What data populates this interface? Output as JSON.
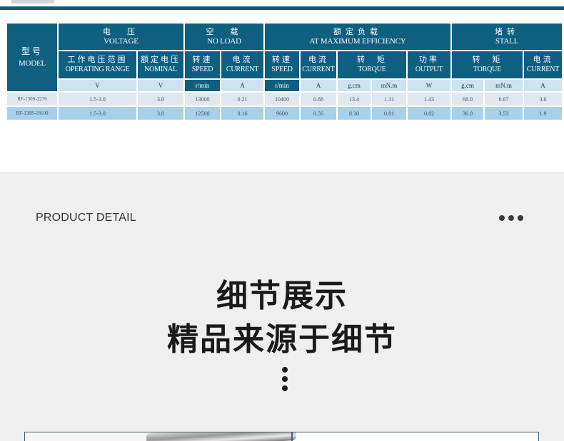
{
  "colors": {
    "header": "#0f5f80",
    "unit_row": "#cfe3ee",
    "row1": "#dfe8ee",
    "row2": "#a7d1e8",
    "section_bg": "#efefef"
  },
  "table": {
    "model": {
      "cn": "型号",
      "en": "MODEL"
    },
    "groups": {
      "voltage": {
        "cn": "电　压",
        "en": "VOLTAGE"
      },
      "no_load": {
        "cn": "空　载",
        "en": "NO LOAD"
      },
      "max_eff": {
        "cn": "额定负载",
        "en": "AT MAXIMUM EFFICIENCY"
      },
      "stall": {
        "cn": "堵转",
        "en": "STALL"
      }
    },
    "sub": {
      "op_range": {
        "cn": "工作电压范围",
        "en": "OPERATING RANGE"
      },
      "nominal": {
        "cn": "额定电压",
        "en": "NOMINAL"
      },
      "nl_speed": {
        "cn": "转速",
        "en": "SPEED"
      },
      "nl_current": {
        "cn": "电流",
        "en": "CURRENT"
      },
      "me_speed": {
        "cn": "转速",
        "en": "SPEED"
      },
      "me_current": {
        "cn": "电流",
        "en": "CURRENT"
      },
      "me_torque": {
        "cn": "转　矩",
        "en": "TORQUE"
      },
      "me_output": {
        "cn": "功率",
        "en": "OUTPUT"
      },
      "st_torque": {
        "cn": "转　矩",
        "en": "TORQUE"
      },
      "st_current": {
        "cn": "电流",
        "en": "CURRENT"
      }
    },
    "units": [
      "V",
      "V",
      "r/min",
      "A",
      "r/min",
      "A",
      "g.cm",
      "mN.m",
      "W",
      "g.cm",
      "mN.m",
      "A"
    ],
    "rows": [
      [
        "RF-130S-2270",
        "1.5-3.0",
        "3.0",
        "13000",
        "0.21",
        "10400",
        "0.88",
        "13.4",
        "1.31",
        "1.43",
        "68.0",
        "6.67",
        "3.6"
      ],
      [
        "RF-130S-18100",
        "1.5-3.0",
        "3.0",
        "12500",
        "0.16",
        "9600",
        "0.56",
        "8.30",
        "0.81",
        "0.82",
        "36.0",
        "3.53",
        "1.9"
      ]
    ]
  },
  "detail": {
    "label": "PRODUCT DETAIL",
    "more_icon": "more-horizontal-icon",
    "title_line1": "细节展示",
    "title_line2": "精品来源于细节"
  }
}
